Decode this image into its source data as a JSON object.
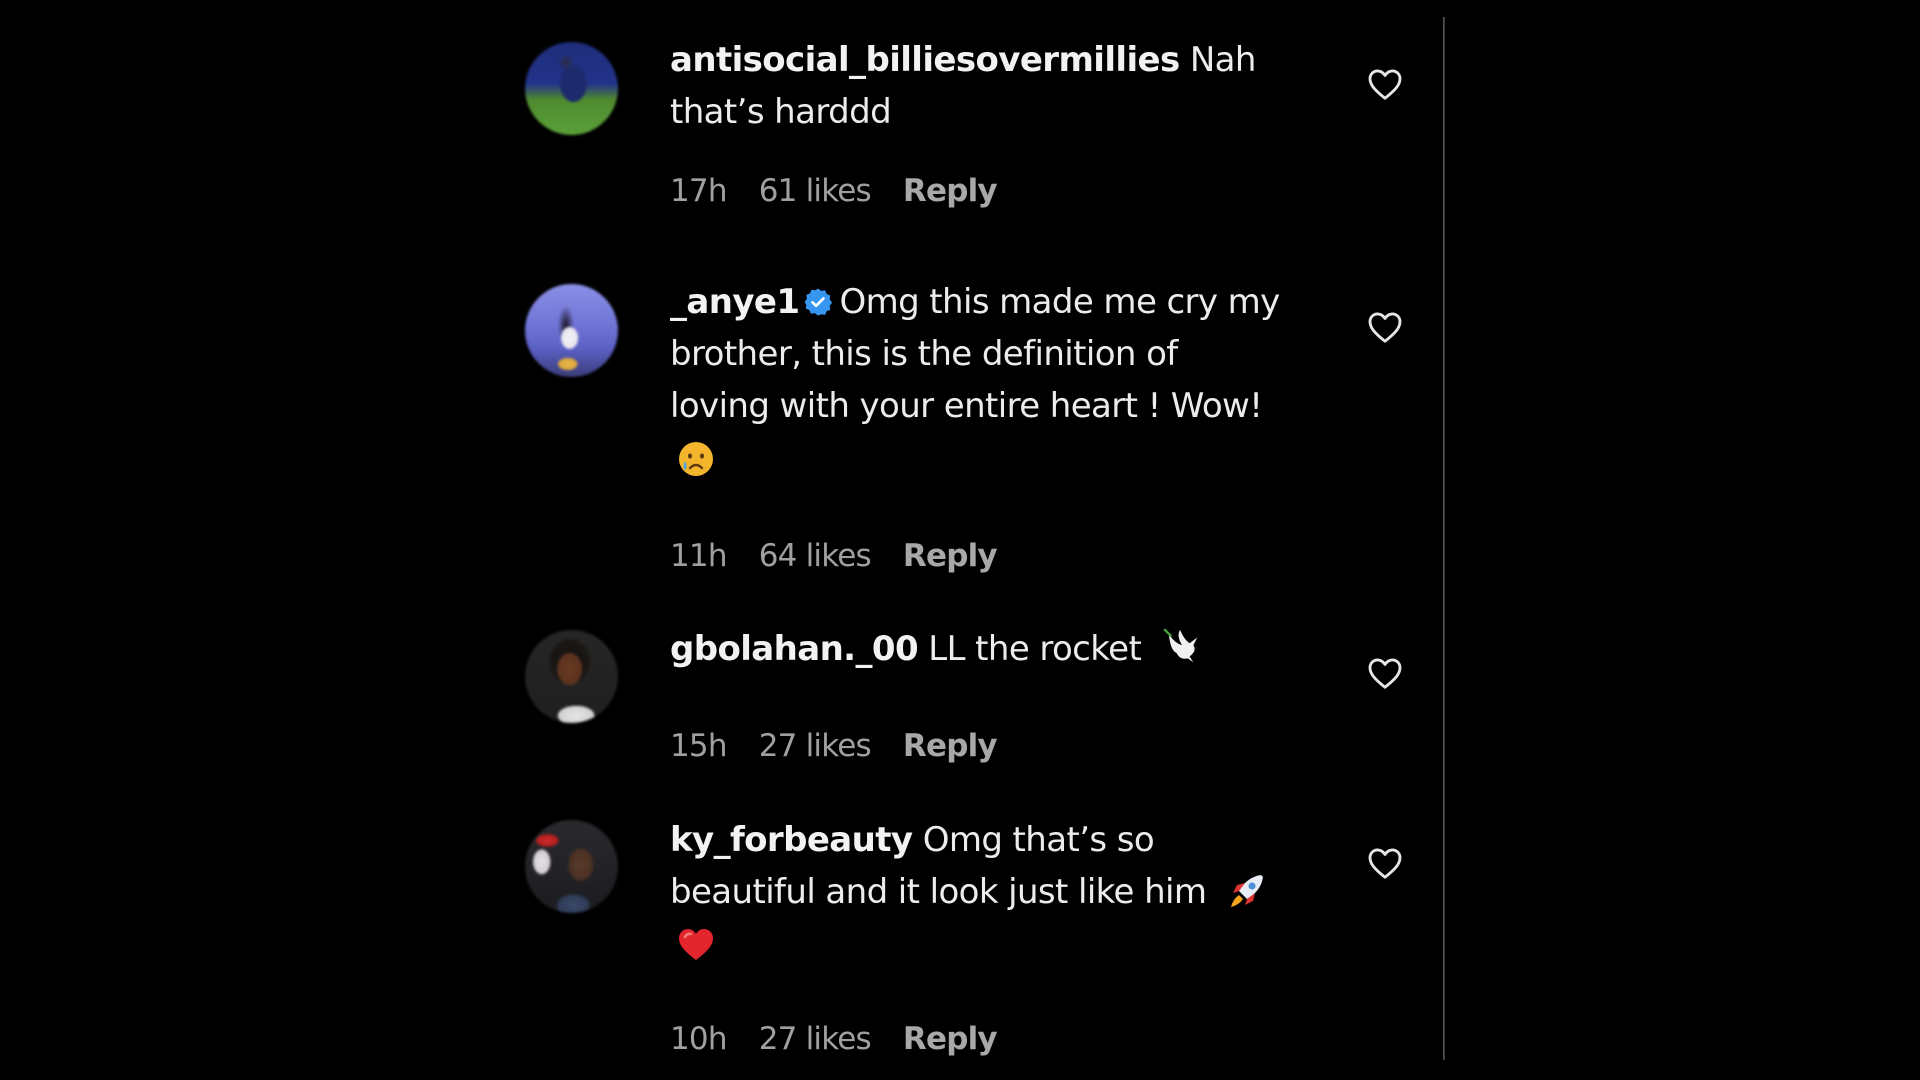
{
  "comments": [
    {
      "username": "antisocial_billiesovermillies",
      "verified": false,
      "text_lines": [
        "Nah",
        "that’s harddd"
      ],
      "time": "17h",
      "likes": "61 likes",
      "reply_label": "Reply",
      "avatar_icon": "avatar-photo-soccer-player"
    },
    {
      "username": "_anye1",
      "verified": true,
      "text_lines": [
        "Omg this made me cry my",
        "brother, this is the definition of",
        "loving with your entire heart ! Wow!"
      ],
      "emoji": "😢",
      "time": "11h",
      "likes": "64 likes",
      "reply_label": "Reply",
      "avatar_icon": "avatar-photo-woman"
    },
    {
      "username": "gbolahan._00",
      "verified": false,
      "text_lines": [
        "LL the rocket"
      ],
      "trailing_emoji": "🕊️",
      "time": "15h",
      "likes": "27 likes",
      "reply_label": "Reply",
      "avatar_icon": "avatar-photo-man"
    },
    {
      "username": "ky_forbeauty",
      "verified": false,
      "text_lines": [
        "Omg that’s so",
        "beautiful and it look just like him"
      ],
      "trailing_emoji": "🚀",
      "emoji": "❤️",
      "time": "10h",
      "likes": "27 likes",
      "reply_label": "Reply",
      "avatar_icon": "avatar-photo-girl"
    }
  ],
  "colors": {
    "background": "#000000",
    "text": "#ececec",
    "meta_text": "#a0a0a0",
    "verified_badge": "#3797f0",
    "heart_emoji": "#e3262e"
  }
}
